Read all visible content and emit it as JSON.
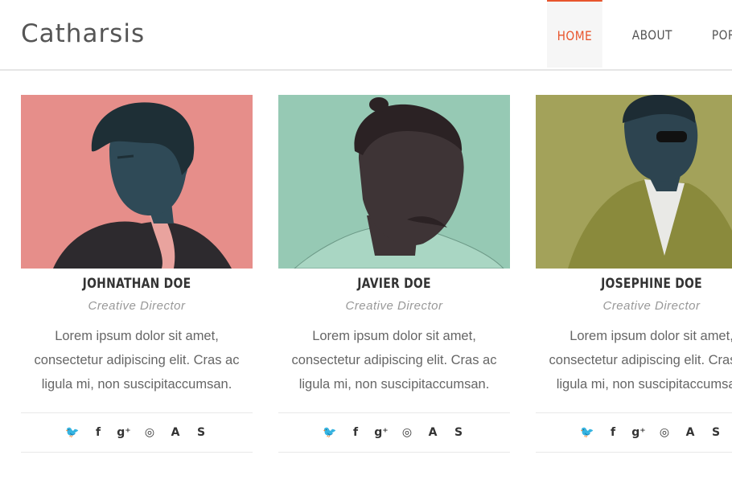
{
  "header": {
    "logo": "Catharsis",
    "nav": [
      {
        "label": "HOME",
        "active": true
      },
      {
        "label": "ABOUT",
        "active": false
      },
      {
        "label": "PORT",
        "active": false
      }
    ]
  },
  "colors": {
    "accent": "#e8552d",
    "card_bg": [
      "#e68e8a",
      "#96c9b4",
      "#a3a25a"
    ]
  },
  "team": [
    {
      "name": "JOHNATHAN DOE",
      "role": "Creative Director",
      "bio": [
        "Lorem ipsum dolor sit amet,",
        "consectetur adipiscing elit. Cras ac",
        "ligula mi, non suscipitaccumsan."
      ]
    },
    {
      "name": "JAVIER DOE",
      "role": "Creative Director",
      "bio": [
        "Lorem ipsum dolor sit amet,",
        "consectetur adipiscing elit. Cras ac",
        "ligula mi, non suscipitaccumsan."
      ]
    },
    {
      "name": "JOSEPHINE DOE",
      "role": "Creative Director",
      "bio": [
        "Lorem ipsum dolor sit amet,",
        "consectetur adipiscing elit. Cras ac",
        "ligula mi, non suscipitaccumsan."
      ]
    }
  ],
  "social_icons": [
    "twitter-icon",
    "facebook-icon",
    "google-plus-icon",
    "dribbble-icon",
    "behance-icon",
    "skype-icon"
  ],
  "social_glyphs": {
    "twitter": "🐦",
    "facebook": "f",
    "google_plus": "g⁺",
    "dribbble": "◎",
    "behance": "A",
    "skype": "S"
  }
}
